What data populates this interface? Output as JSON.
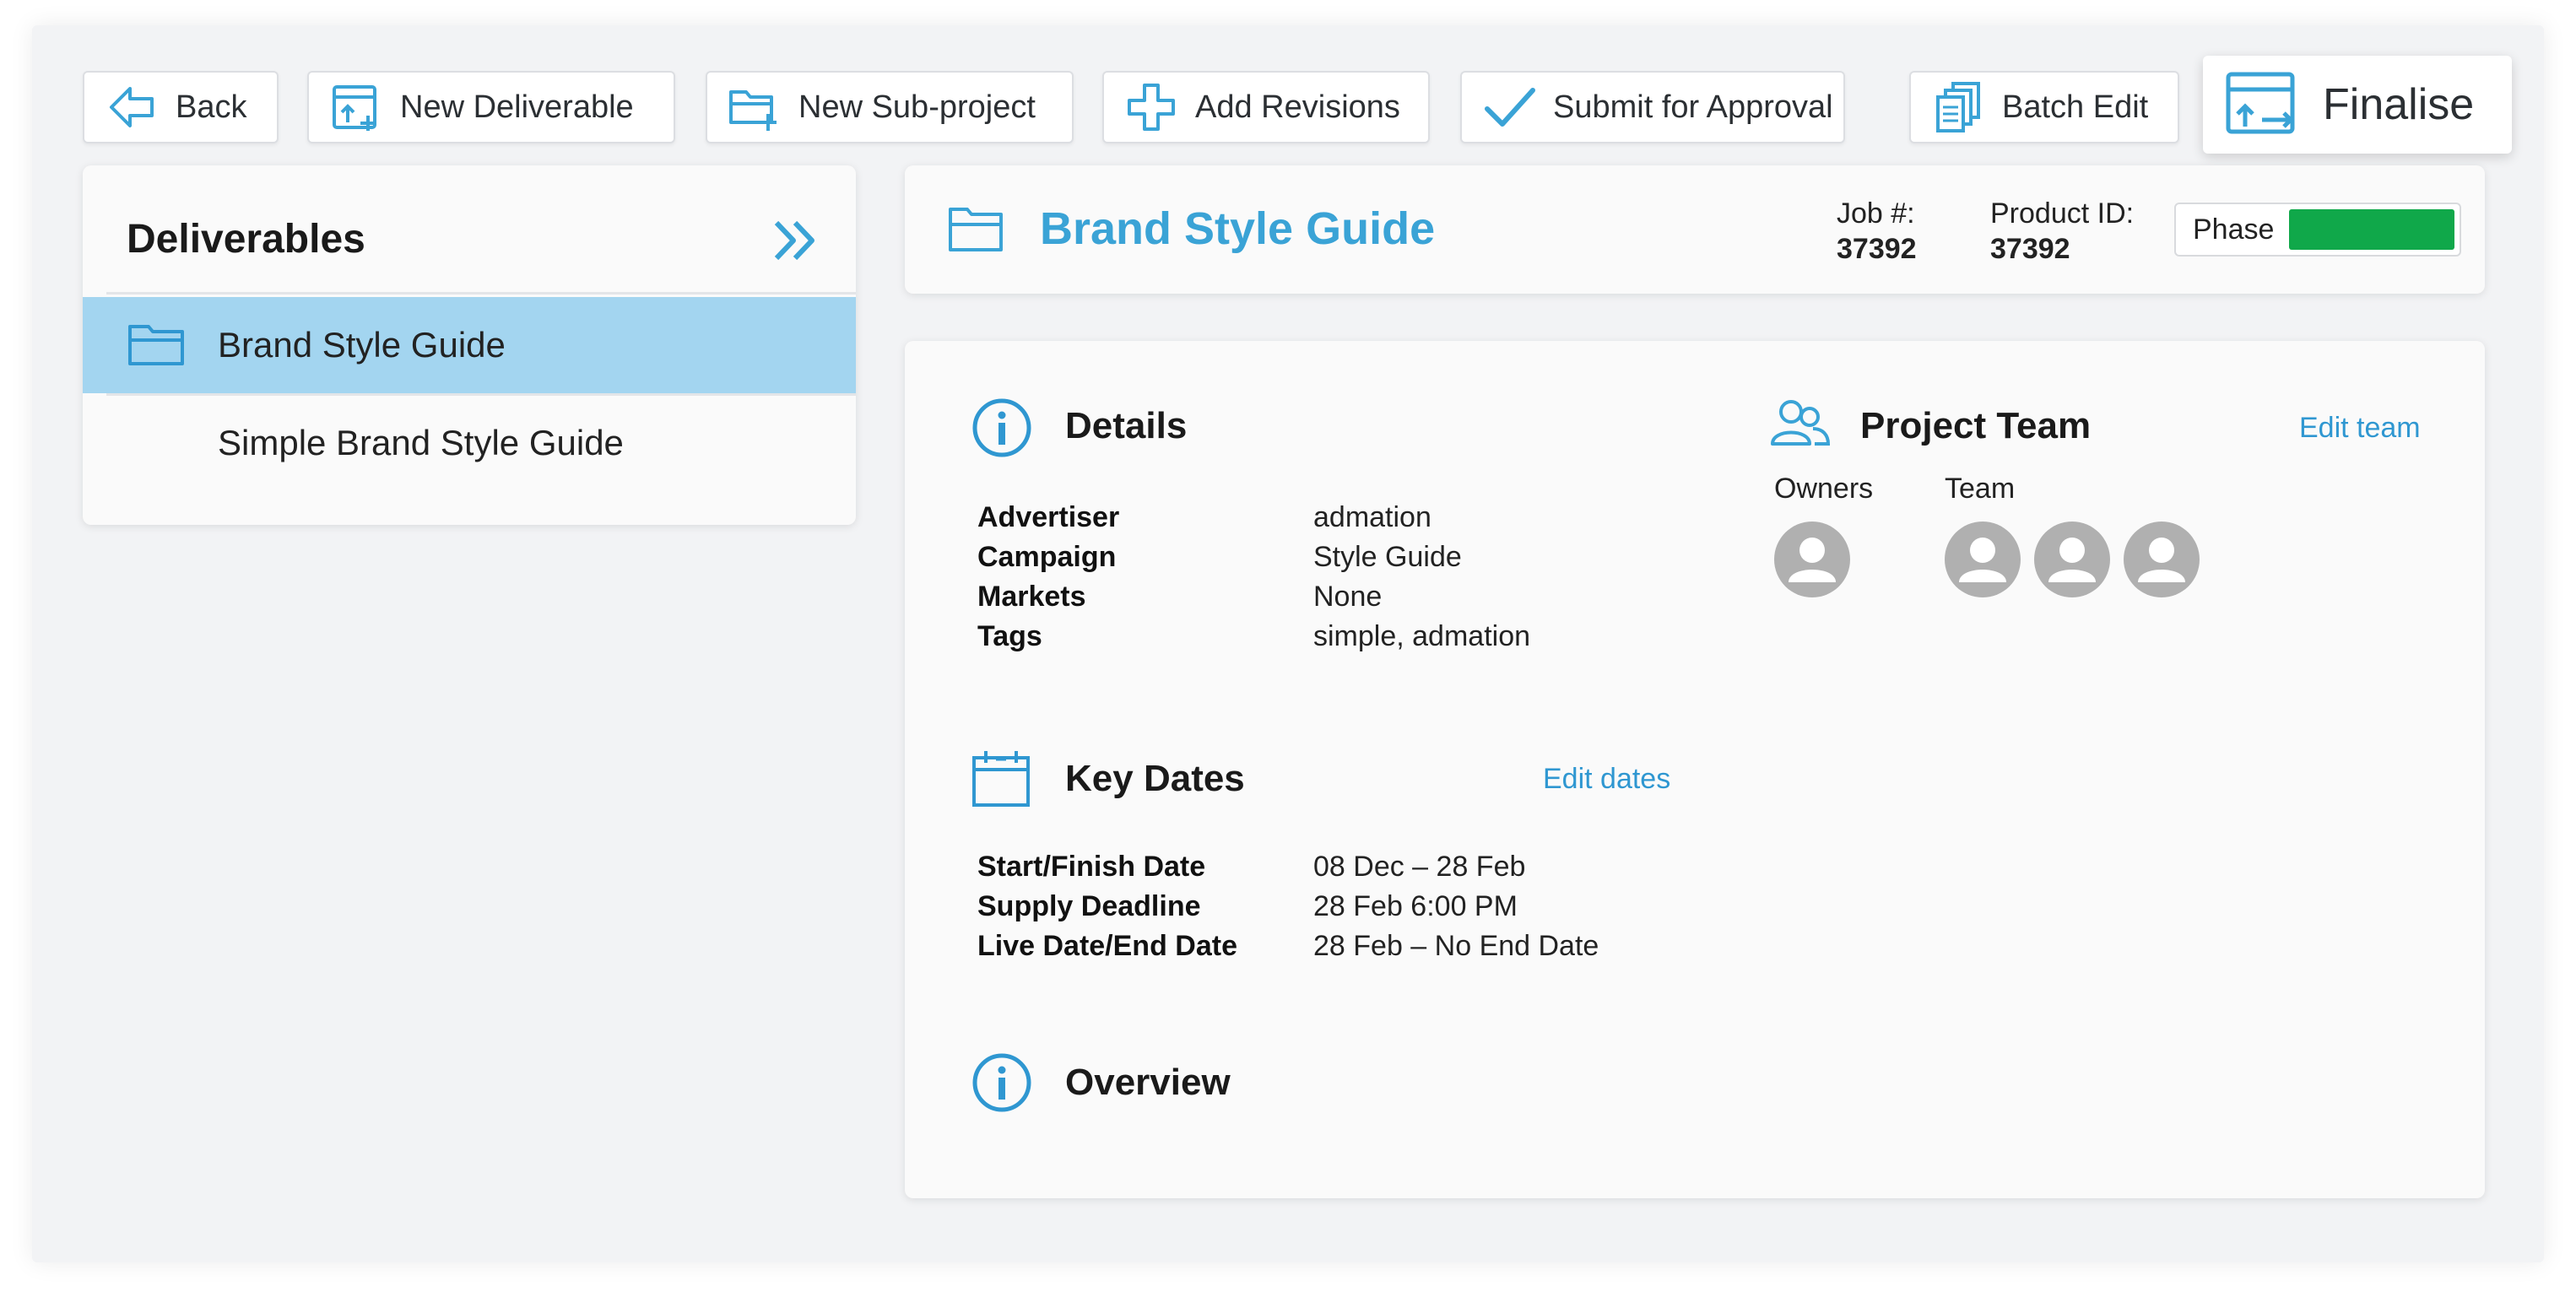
{
  "toolbar": {
    "back": "Back",
    "new_deliverable": "New Deliverable",
    "new_subproject": "New Sub-project",
    "add_revisions": "Add Revisions",
    "submit_for_approval": "Submit for Approval",
    "batch_edit": "Batch Edit",
    "finalise": "Finalise"
  },
  "sidebar": {
    "title": "Deliverables",
    "items": [
      {
        "label": "Brand Style Guide",
        "selected": true,
        "icon": "folder-icon"
      },
      {
        "label": "Simple Brand Style Guide",
        "selected": false
      }
    ]
  },
  "header": {
    "title": "Brand Style Guide",
    "job_label": "Job #:",
    "job_value": "37392",
    "product_label": "Product ID:",
    "product_value": "37392",
    "phase_label": "Phase",
    "phase_color": "#10a84a"
  },
  "details": {
    "title": "Details",
    "rows": [
      {
        "label": "Advertiser",
        "value": "admation"
      },
      {
        "label": "Campaign",
        "value": "Style Guide"
      },
      {
        "label": "Markets",
        "value": "None"
      },
      {
        "label": "Tags",
        "value": "simple, admation"
      }
    ]
  },
  "team": {
    "title": "Project Team",
    "edit_link": "Edit team",
    "owners_label": "Owners",
    "team_label": "Team",
    "owner_count": 1,
    "member_count": 3
  },
  "key_dates": {
    "title": "Key Dates",
    "edit_link": "Edit dates",
    "rows": [
      {
        "label": "Start/Finish Date",
        "value": "08 Dec – 28 Feb"
      },
      {
        "label": "Supply Deadline",
        "value": "28 Feb 6:00 PM"
      },
      {
        "label": "Live Date/End Date",
        "value": "28 Feb – No End Date"
      }
    ]
  },
  "overview": {
    "title": "Overview"
  },
  "colors": {
    "accent": "#3aa3d6",
    "link": "#2f97d1",
    "selected_row": "#a3d5f0",
    "phase": "#10a84a"
  }
}
